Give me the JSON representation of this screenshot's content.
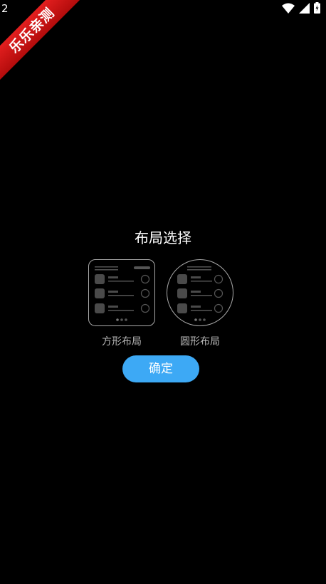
{
  "status_bar": {
    "time": "2"
  },
  "ribbon": {
    "text": "乐乐亲测"
  },
  "dialog": {
    "title": "布局选择",
    "options": [
      {
        "label": "方形布局"
      },
      {
        "label": "圆形布局"
      }
    ],
    "confirm_label": "确定"
  },
  "colors": {
    "accent": "#3da9f5",
    "background": "#000000",
    "ribbon": "#d0151b"
  }
}
